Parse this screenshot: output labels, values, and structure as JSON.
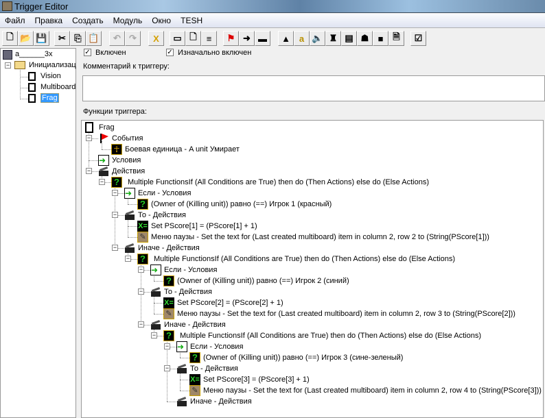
{
  "window": {
    "title": "Trigger Editor"
  },
  "menu": [
    "Файл",
    "Правка",
    "Создать",
    "Модуль",
    "Окно",
    "TESH"
  ],
  "toolbar": [
    {
      "icon": "new-icon",
      "g": "🗋"
    },
    {
      "icon": "open-icon",
      "g": "📂"
    },
    {
      "icon": "save-icon",
      "g": "💾"
    },
    {
      "icon": "cut-icon",
      "g": "✂"
    },
    {
      "icon": "copy-icon",
      "g": "⎘"
    },
    {
      "icon": "paste-icon",
      "g": "📋"
    },
    {
      "icon": "undo-icon",
      "g": "↶"
    },
    {
      "icon": "redo-icon",
      "g": "↷"
    },
    {
      "icon": "delete-icon",
      "g": "X"
    },
    {
      "icon": "new-category-icon",
      "g": "▭"
    },
    {
      "icon": "new-trigger-icon",
      "g": "🗋"
    },
    {
      "icon": "new-comment-icon",
      "g": "≡"
    },
    {
      "icon": "new-event-icon",
      "g": "⚑"
    },
    {
      "icon": "new-condition-icon",
      "g": "➜"
    },
    {
      "icon": "new-action-icon",
      "g": "▬"
    },
    {
      "icon": "terrain-editor-icon",
      "g": "▲"
    },
    {
      "icon": "trigger-editor-icon",
      "g": "a"
    },
    {
      "icon": "sound-editor-icon",
      "g": "🔈"
    },
    {
      "icon": "object-editor-icon",
      "g": "♜"
    },
    {
      "icon": "campaign-editor-icon",
      "g": "▤"
    },
    {
      "icon": "ai-editor-icon",
      "g": "☗"
    },
    {
      "icon": "import-manager-icon",
      "g": "■"
    },
    {
      "icon": "export-icon",
      "g": "🗎"
    },
    {
      "icon": "test-map-icon",
      "g": "☑"
    }
  ],
  "left_tree": {
    "map": "a______3x",
    "category": "Инициализац",
    "triggers": [
      "Vision",
      "Multiboard",
      "Frag"
    ],
    "selected": "Frag"
  },
  "trigger": {
    "enabled_label": "Включен",
    "enabled": true,
    "initially_on_label": "Изначально включен",
    "initially_on": true,
    "comment_label": "Комментарий к триггеру:",
    "comment": "",
    "functions_label": "Функции триггера:"
  },
  "tree": [
    {
      "l": 0,
      "i": "doc",
      "t": "Frag"
    },
    {
      "l": 1,
      "i": "flag",
      "t": "События",
      "e": 1
    },
    {
      "l": 2,
      "i": "unit",
      "t": "Боевая единица - A unit Умирает"
    },
    {
      "l": 1,
      "i": "cond",
      "t": "Условия"
    },
    {
      "l": 1,
      "i": "act",
      "t": "Действия",
      "e": 1
    },
    {
      "l": 2,
      "i": "q",
      "t": "Multiple FunctionsIf (All Conditions are True) then do (Then Actions) else do (Else Actions)",
      "e": 1
    },
    {
      "l": 3,
      "i": "cond",
      "t": "Если - Условия",
      "e": 1
    },
    {
      "l": 4,
      "i": "q",
      "t": "(Owner of (Killing unit)) равно (==) Игрок 1 (красный)"
    },
    {
      "l": 3,
      "i": "act",
      "t": "То - Действия",
      "e": 1
    },
    {
      "l": 4,
      "i": "set",
      "t": "Set PScore[1] = (PScore[1] + 1)"
    },
    {
      "l": 4,
      "i": "pen",
      "t": "Меню паузы - Set the text for (Last created multiboard) item in column 2, row 2 to (String(PScore[1]))"
    },
    {
      "l": 3,
      "i": "act",
      "t": "Иначе - Действия",
      "e": 1
    },
    {
      "l": 4,
      "i": "q",
      "t": "Multiple FunctionsIf (All Conditions are True) then do (Then Actions) else do (Else Actions)",
      "e": 1
    },
    {
      "l": 5,
      "i": "cond",
      "t": "Если - Условия",
      "e": 1
    },
    {
      "l": 6,
      "i": "q",
      "t": "(Owner of (Killing unit)) равно (==) Игрок 2 (синий)"
    },
    {
      "l": 5,
      "i": "act",
      "t": "То - Действия",
      "e": 1
    },
    {
      "l": 6,
      "i": "set",
      "t": "Set PScore[2] = (PScore[2] + 1)"
    },
    {
      "l": 6,
      "i": "pen",
      "t": "Меню паузы - Set the text for (Last created multiboard) item in column 2, row 3 to (String(PScore[2]))"
    },
    {
      "l": 5,
      "i": "act",
      "t": "Иначе - Действия",
      "e": 1
    },
    {
      "l": 6,
      "i": "q",
      "t": "Multiple FunctionsIf (All Conditions are True) then do (Then Actions) else do (Else Actions)",
      "e": 1
    },
    {
      "l": 7,
      "i": "cond",
      "t": "Если - Условия",
      "e": 1
    },
    {
      "l": 8,
      "i": "q",
      "t": "(Owner of (Killing unit)) равно (==) Игрок 3 (сине-зеленый)"
    },
    {
      "l": 7,
      "i": "act",
      "t": "То - Действия",
      "e": 1
    },
    {
      "l": 8,
      "i": "set",
      "t": "Set PScore[3] = (PScore[3] + 1)"
    },
    {
      "l": 8,
      "i": "pen",
      "t": "Меню паузы - Set the text for (Last created multiboard) item in column 2, row 4 to (String(PScore[3]))"
    },
    {
      "l": 7,
      "i": "act",
      "t": "Иначе - Действия"
    }
  ]
}
